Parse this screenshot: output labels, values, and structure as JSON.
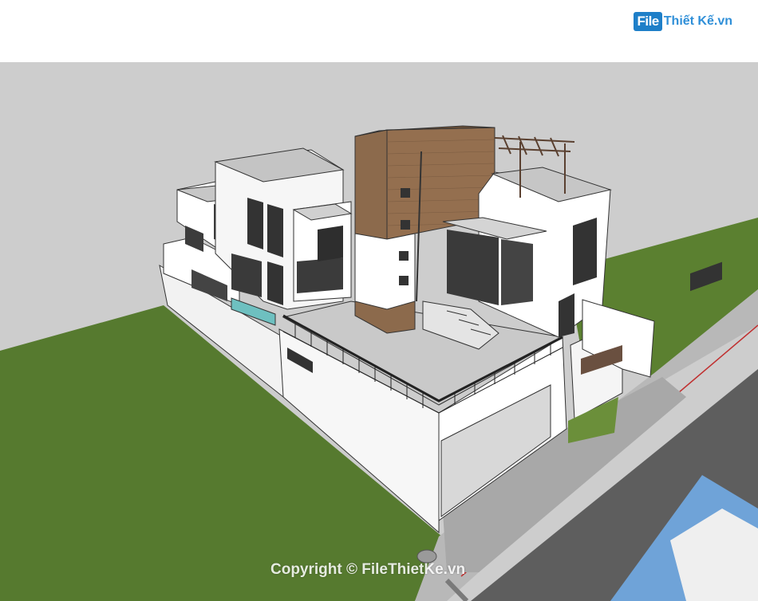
{
  "header": {
    "logo_part1": "File",
    "logo_part2": "Thiết Kế.vn"
  },
  "watermark": "Copyright © FileThietKe.vn",
  "colors": {
    "sky": "#cdcdcd",
    "lawn": "#567a2f",
    "road": "#5e5e5e",
    "sidewalk": "#b9b9b9",
    "wall": "#ffffff",
    "wood": "#8c6a4c",
    "glass": "#4a4a4a",
    "roof": "#bdbdbd",
    "brand_blue": "#2f8fd8"
  }
}
